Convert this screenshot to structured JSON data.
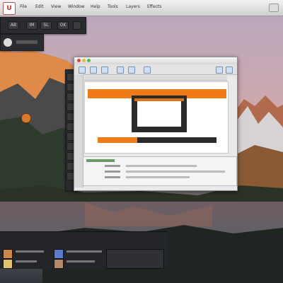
{
  "app": {
    "icon_letter": "U"
  },
  "menubar": {
    "items": [
      "File",
      "Edit",
      "View",
      "Window",
      "Help",
      "Tools",
      "Layers",
      "Effects"
    ]
  },
  "toolbar_left": {
    "buttons": [
      "AB",
      "IM",
      "SL",
      "OK"
    ]
  },
  "main_window": {
    "title": "",
    "props_rows": [
      {
        "label": "",
        "value": ""
      },
      {
        "label": "",
        "value": ""
      },
      {
        "label": "",
        "value": ""
      },
      {
        "label": "",
        "value": ""
      }
    ]
  },
  "colors": {
    "accent_orange": "#f07a18",
    "dark_panel": "#2b2c2f",
    "frame_black": "#2a2a2a"
  }
}
